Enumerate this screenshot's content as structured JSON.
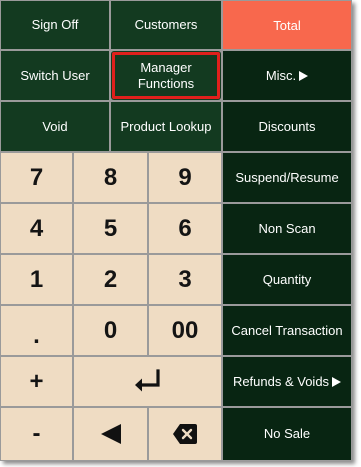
{
  "keys": {
    "sign_off": "Sign Off",
    "customers": "Customers",
    "total": "Total",
    "switch_user": "Switch User",
    "manager_functions": "Manager Functions",
    "misc": "Misc.",
    "void": "Void",
    "product_lookup": "Product Lookup",
    "discounts": "Discounts",
    "suspend_resume": "Suspend/Resume",
    "non_scan": "Non Scan",
    "quantity": "Quantity",
    "cancel_transaction": "Cancel Transaction",
    "refunds_voids": "Refunds & Voids",
    "no_sale": "No Sale"
  },
  "keypad": {
    "seven": "7",
    "eight": "8",
    "nine": "9",
    "four": "4",
    "five": "5",
    "six": "6",
    "one": "1",
    "two": "2",
    "three": "3",
    "dot": ".",
    "zero": "0",
    "double_zero": "00",
    "plus": "+",
    "minus": "-"
  },
  "icons": {
    "misc_arrow": "arrow-right-icon",
    "refunds_arrow": "arrow-right-icon",
    "enter": "enter-icon",
    "back": "left-arrow-icon",
    "backspace": "backspace-icon"
  },
  "colors": {
    "function_key": "#133a20",
    "keypad": "#efdcc3",
    "total": "#f8684d",
    "highlight": "#e0201c"
  }
}
